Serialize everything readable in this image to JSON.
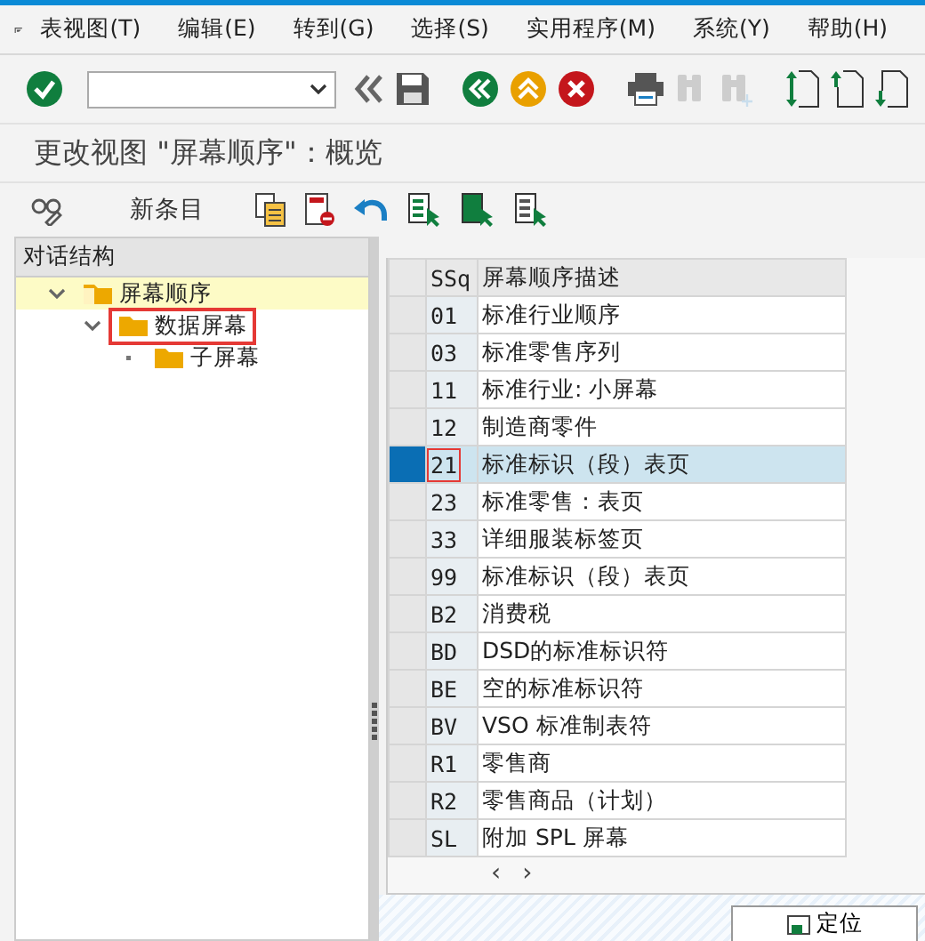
{
  "menu": [
    "表视图(T)",
    "编辑(E)",
    "转到(G)",
    "选择(S)",
    "实用程序(M)",
    "系统(Y)",
    "帮助(H)"
  ],
  "toolbar": [
    {
      "kind": "enter",
      "disabled": false
    },
    {
      "kind": "command"
    },
    {
      "kind": "chevron"
    },
    {
      "kind": "save",
      "disabled": false
    },
    {
      "kind": "back",
      "disabled": false
    },
    {
      "kind": "exit",
      "disabled": false
    },
    {
      "kind": "cancel",
      "disabled": false
    },
    {
      "kind": "print",
      "disabled": false
    },
    {
      "kind": "find",
      "disabled": true
    },
    {
      "kind": "findnext",
      "disabled": true
    },
    {
      "kind": "first",
      "disabled": false
    },
    {
      "kind": "prev",
      "disabled": false
    },
    {
      "kind": "next",
      "disabled": false
    }
  ],
  "title": "更改视图 \"屏幕顺序\"：概览",
  "app_toolbar": [
    {
      "kind": "display"
    },
    {
      "kind": "text",
      "label": "新条目"
    },
    {
      "kind": "copy"
    },
    {
      "kind": "delete"
    },
    {
      "kind": "undo"
    },
    {
      "kind": "selall"
    },
    {
      "kind": "selblock"
    },
    {
      "kind": "deselall"
    }
  ],
  "tree": {
    "header": "对话结构",
    "items": [
      {
        "label": "屏幕顺序",
        "expanded": true,
        "selected": true,
        "annotated": false,
        "children": [
          {
            "label": "数据屏幕",
            "expanded": true,
            "selected": false,
            "annotated": true,
            "children": [
              {
                "label": "子屏幕",
                "selected": false,
                "annotated": false
              }
            ]
          }
        ]
      }
    ]
  },
  "table": {
    "columns": [
      "SSq",
      "屏幕顺序描述"
    ],
    "rows": [
      {
        "code": "01",
        "desc": "标准行业顺序",
        "selected": false
      },
      {
        "code": "03",
        "desc": "标准零售序列",
        "selected": false
      },
      {
        "code": "11",
        "desc": "标准行业: 小屏幕",
        "selected": false
      },
      {
        "code": "12",
        "desc": "制造商零件",
        "selected": false
      },
      {
        "code": "21",
        "desc": "标准标识（段）表页",
        "selected": true
      },
      {
        "code": "23",
        "desc": "标准零售：表页",
        "selected": false
      },
      {
        "code": "33",
        "desc": "详细服装标签页",
        "selected": false
      },
      {
        "code": "99",
        "desc": "标准标识（段）表页",
        "selected": false
      },
      {
        "code": "B2",
        "desc": "消费税",
        "selected": false
      },
      {
        "code": "BD",
        "desc": "DSD的标准标识符",
        "selected": false
      },
      {
        "code": "BE",
        "desc": "空的标准标识符",
        "selected": false
      },
      {
        "code": "BV",
        "desc": "VSO 标准制表符",
        "selected": false
      },
      {
        "code": "R1",
        "desc": "零售商",
        "selected": false
      },
      {
        "code": "R2",
        "desc": "零售商品（计划）",
        "selected": false
      },
      {
        "code": "SL",
        "desc": "附加 SPL 屏幕",
        "selected": false
      }
    ],
    "scroll": [
      "‹",
      "›"
    ]
  },
  "footer_button": "定位"
}
